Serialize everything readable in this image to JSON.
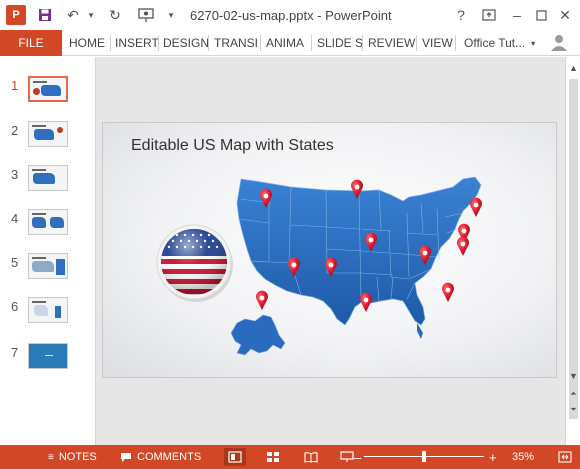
{
  "window": {
    "title": "6270-02-us-map.pptx - PowerPoint",
    "help": "?",
    "minimize": "–",
    "close": "✕"
  },
  "ribbon": {
    "file": "FILE",
    "tabs": [
      "HOME",
      "INSERT",
      "DESIGN",
      "TRANSI",
      "ANIMA",
      "SLIDE S",
      "REVIEW",
      "VIEW"
    ],
    "account": "Office Tut..."
  },
  "thumbnails": {
    "numbers": [
      "1",
      "2",
      "3",
      "4",
      "5",
      "6",
      "7"
    ],
    "selected": "1"
  },
  "slide": {
    "title": "Editable US Map with States"
  },
  "statusbar": {
    "notes": "NOTES",
    "comments": "COMMENTS",
    "zoom": "35%",
    "zoom_fraction": 0.5
  },
  "colors": {
    "accent": "#d24726",
    "map_fill": "#2a6bbf",
    "pin": "#e0182d"
  }
}
